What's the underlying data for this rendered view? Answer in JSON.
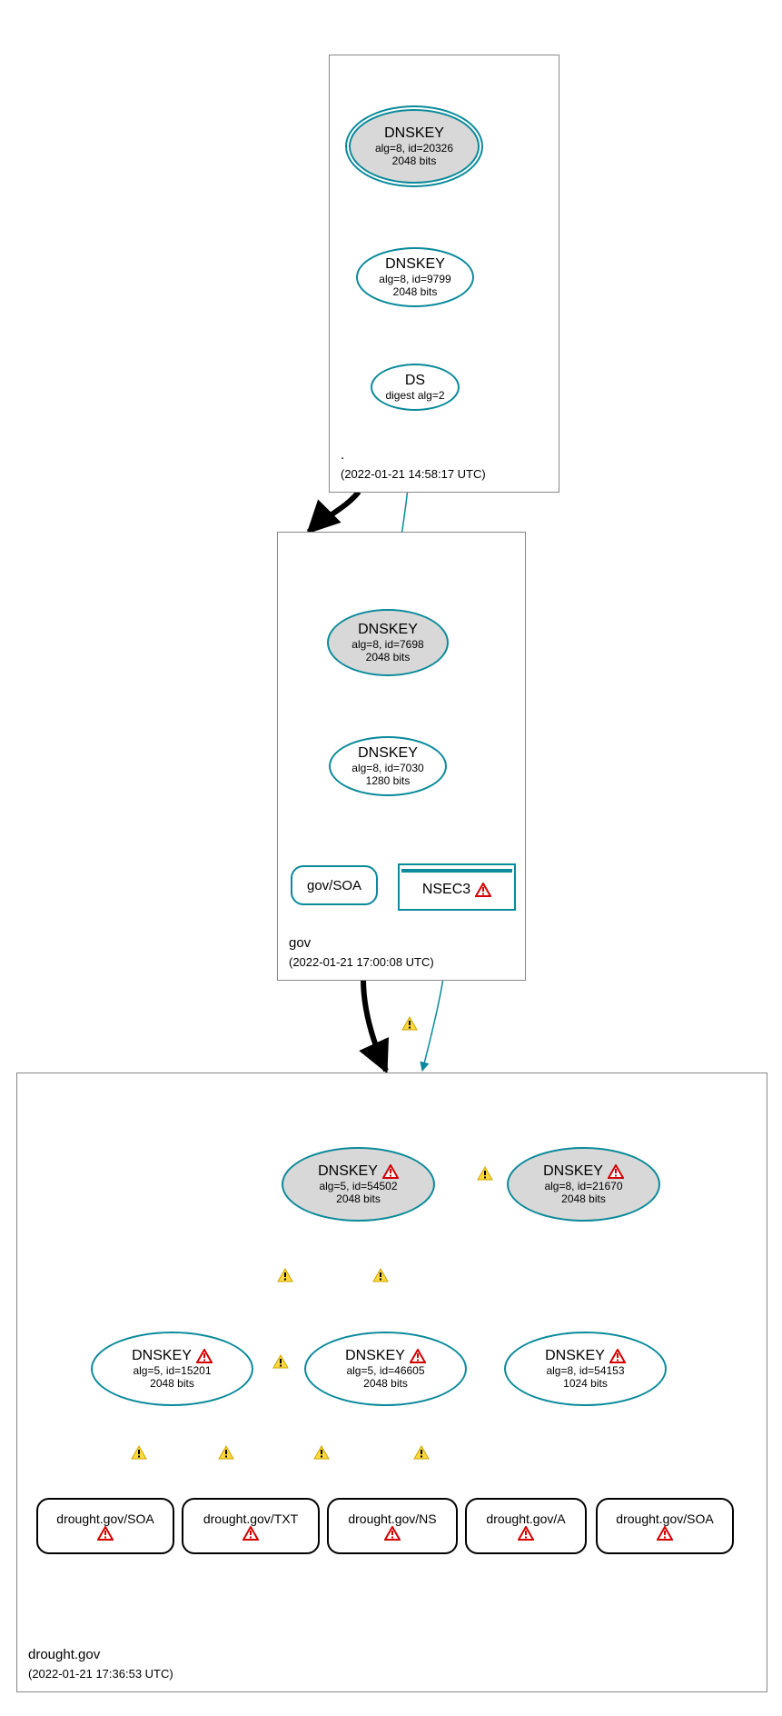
{
  "zones": {
    "root": {
      "label": ".",
      "timestamp": "(2022-01-21 14:58:17 UTC)"
    },
    "gov": {
      "label": "gov",
      "timestamp": "(2022-01-21 17:00:08 UTC)"
    },
    "drought": {
      "label": "drought.gov",
      "timestamp": "(2022-01-21 17:36:53 UTC)"
    }
  },
  "nodes": {
    "root_ksk": {
      "title": "DNSKEY",
      "sub1": "alg=8, id=20326",
      "sub2": "2048 bits"
    },
    "root_zsk": {
      "title": "DNSKEY",
      "sub1": "alg=8, id=9799",
      "sub2": "2048 bits"
    },
    "root_ds": {
      "title": "DS",
      "sub1": "digest alg=2"
    },
    "gov_ksk": {
      "title": "DNSKEY",
      "sub1": "alg=8, id=7698",
      "sub2": "2048 bits"
    },
    "gov_zsk": {
      "title": "DNSKEY",
      "sub1": "alg=8, id=7030",
      "sub2": "1280 bits"
    },
    "gov_soa": {
      "title": "gov/SOA"
    },
    "gov_nsec3": {
      "title": "NSEC3"
    },
    "d_ksk1": {
      "title": "DNSKEY",
      "sub1": "alg=5, id=54502",
      "sub2": "2048 bits"
    },
    "d_ksk2": {
      "title": "DNSKEY",
      "sub1": "alg=8, id=21670",
      "sub2": "2048 bits"
    },
    "d_zsk1": {
      "title": "DNSKEY",
      "sub1": "alg=5, id=15201",
      "sub2": "2048 bits"
    },
    "d_zsk2": {
      "title": "DNSKEY",
      "sub1": "alg=5, id=46605",
      "sub2": "2048 bits"
    },
    "d_zsk3": {
      "title": "DNSKEY",
      "sub1": "alg=8, id=54153",
      "sub2": "1024 bits"
    },
    "d_soa1": {
      "title": "drought.gov/SOA"
    },
    "d_txt": {
      "title": "drought.gov/TXT"
    },
    "d_ns": {
      "title": "drought.gov/NS"
    },
    "d_a": {
      "title": "drought.gov/A"
    },
    "d_soa2": {
      "title": "drought.gov/SOA"
    }
  }
}
